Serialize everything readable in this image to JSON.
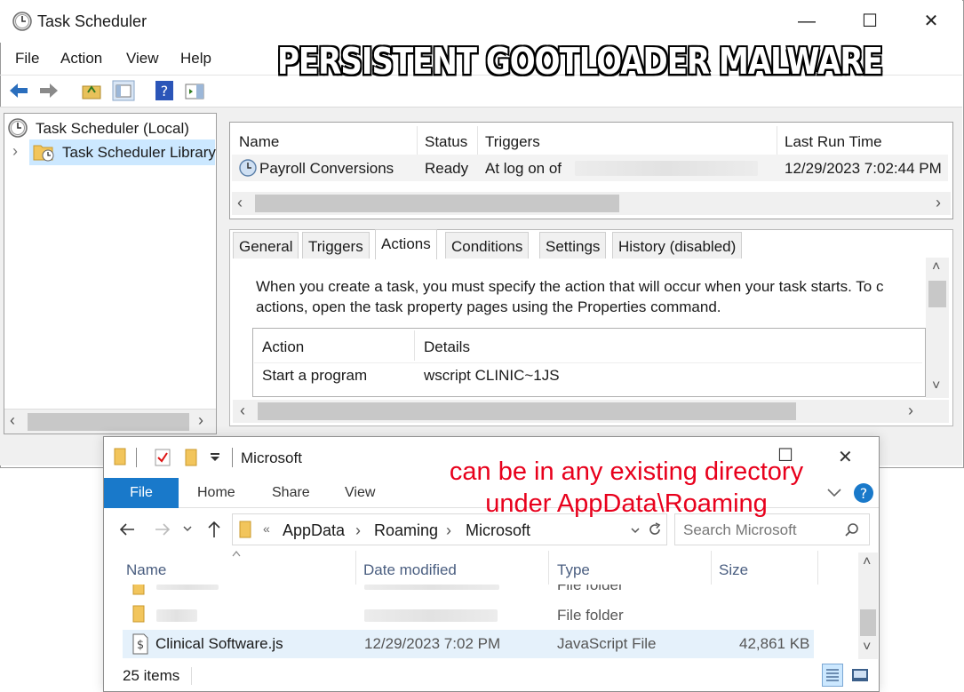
{
  "overlay_title": "PERSISTENT  GOOTLOADER  MALWARE",
  "annotation": [
    "can be in any existing directory",
    "under AppData\\Roaming"
  ],
  "task_scheduler": {
    "title": "Task Scheduler",
    "window_controls": {
      "minimize": "—",
      "maximize": "☐",
      "close": "✕"
    },
    "menu": [
      "File",
      "Action",
      "View",
      "Help"
    ],
    "tree": {
      "root": "Task Scheduler (Local)",
      "library": "Task Scheduler Library",
      "expand_glyph": "›"
    },
    "task_list": {
      "columns": [
        "Name",
        "Status",
        "Triggers",
        "Last Run Time"
      ],
      "rows": [
        {
          "name": "Payroll Conversions",
          "status": "Ready",
          "trigger": "At log on of",
          "last_run": "12/29/2023 7:02:44 PM"
        }
      ]
    },
    "tabs": [
      "General",
      "Triggers",
      "Actions",
      "Conditions",
      "Settings",
      "History (disabled)"
    ],
    "active_tab": "Actions",
    "actions_help": [
      "When you create a task, you must specify the action that will occur when your task starts.  To c",
      "actions, open the task property pages using the Properties command."
    ],
    "actions_table": {
      "columns": [
        "Action",
        "Details"
      ],
      "rows": [
        {
          "action": "Start a program",
          "details": "wscript CLINIC~1JS"
        }
      ]
    },
    "scroll_glyphs": {
      "left": "‹",
      "right": "›",
      "up": "˄",
      "down": "˅"
    }
  },
  "explorer": {
    "title": "Microsoft",
    "ribbon": {
      "file": "File",
      "tabs": [
        "Home",
        "Share",
        "View"
      ]
    },
    "address": {
      "prefix": "«",
      "parts": [
        "AppData",
        "Roaming",
        "Microsoft"
      ],
      "separator": "›"
    },
    "search_placeholder": "Search Microsoft",
    "columns": [
      "Name",
      "Date modified",
      "Type",
      "Size"
    ],
    "rows": [
      {
        "name": "",
        "date": "",
        "type": "File folder",
        "size": ""
      },
      {
        "name": "",
        "date": "",
        "type": "File folder",
        "size": ""
      },
      {
        "name": "Clinical Software.js",
        "date": "12/29/2023 7:02 PM",
        "type": "JavaScript File",
        "size": "42,861 KB"
      }
    ],
    "status": "25 items",
    "colors": {
      "file_tab": "#1979ca",
      "selected_row": "#e5f1fb",
      "annotation": "#e8001c"
    }
  }
}
